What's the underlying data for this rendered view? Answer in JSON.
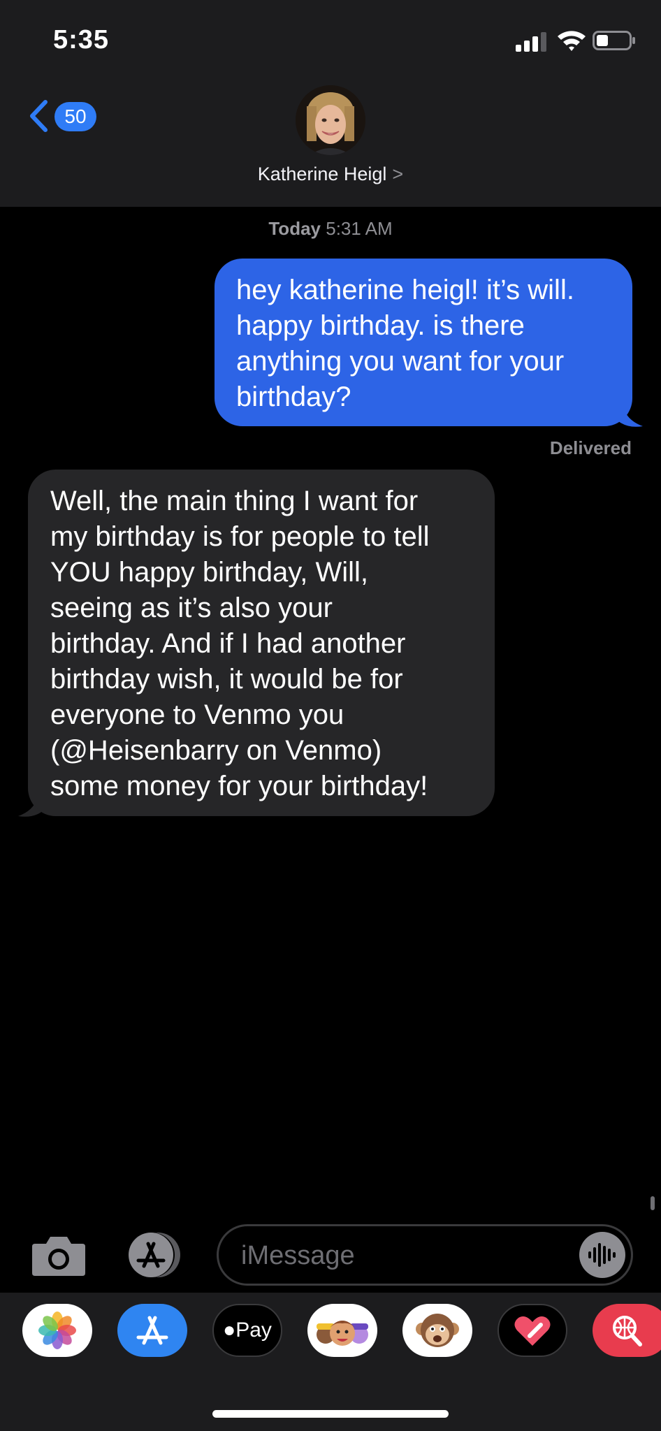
{
  "status_bar": {
    "time": "5:35"
  },
  "nav": {
    "back_badge": "50",
    "contact_name": "Katherine Heigl",
    "contact_chevron": ">"
  },
  "conversation": {
    "timestamp_day": "Today",
    "timestamp_time": "5:31 AM",
    "messages": [
      {
        "direction": "sent",
        "lines": [
          "hey katherine heigl! it’s will.",
          "happy birthday. is there",
          "anything you want for your",
          "birthday?"
        ]
      },
      {
        "direction": "received",
        "lines": [
          "Well, the main thing I want for",
          "my birthday is for people to tell",
          "YOU happy birthday, Will,",
          "seeing as it’s also your",
          "birthday. And if I had another",
          "birthday wish, it would be for",
          "everyone to Venmo you",
          "(@Heisenbarry on Venmo)",
          "some money for your birthday!"
        ]
      }
    ],
    "delivered_label": "Delivered"
  },
  "input": {
    "placeholder": "iMessage"
  },
  "app_drawer": {
    "apps": [
      {
        "name": "Photos",
        "icon": "photos-icon"
      },
      {
        "name": "App Store",
        "icon": "app-store-icon"
      },
      {
        "name": "Apple Pay",
        "icon": "apple-pay-icon",
        "label": "Pay"
      },
      {
        "name": "Memoji",
        "icon": "memoji-icon"
      },
      {
        "name": "Animoji",
        "icon": "monkey-animoji-icon"
      },
      {
        "name": "Digital Touch",
        "icon": "heart-touch-icon"
      },
      {
        "name": "Search",
        "icon": "globe-search-icon"
      }
    ]
  },
  "colors": {
    "sent_bubble": "#2d64e6",
    "received_bubble": "#262628",
    "accent": "#2f7cf6",
    "background": "#000000"
  }
}
